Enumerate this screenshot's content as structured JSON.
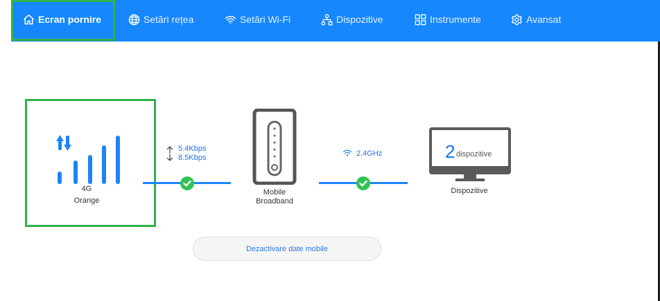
{
  "nav": {
    "items": [
      {
        "label": "Ecran pornire",
        "icon": "home-icon"
      },
      {
        "label": "Setări rețea",
        "icon": "globe-icon"
      },
      {
        "label": "Setări Wi-Fi",
        "icon": "wifi-icon"
      },
      {
        "label": "Dispozitive",
        "icon": "devices-tree-icon"
      },
      {
        "label": "Instrumente",
        "icon": "grid-icon"
      },
      {
        "label": "Avansat",
        "icon": "gear-icon"
      }
    ],
    "active": "Ecran pornire"
  },
  "status": {
    "network_type": "4G",
    "operator": "Orange",
    "upload_speed": "5.4Kbps",
    "download_speed": "8.5Kbps",
    "router_line1": "Mobile",
    "router_line2": "Broadband",
    "wifi_band": "2.4GHz",
    "device_count": "2",
    "device_count_unit": "dispozitive",
    "devices_label": "Dispozitive",
    "signal_bars": 5
  },
  "actions": {
    "disable_mobile_data": "Dezactivare date mobile"
  },
  "colors": {
    "nav_bg": "#1687fd",
    "accent_blue": "#1d84f5",
    "check_green": "#2fc455",
    "highlight_green": "#2fb34a"
  }
}
